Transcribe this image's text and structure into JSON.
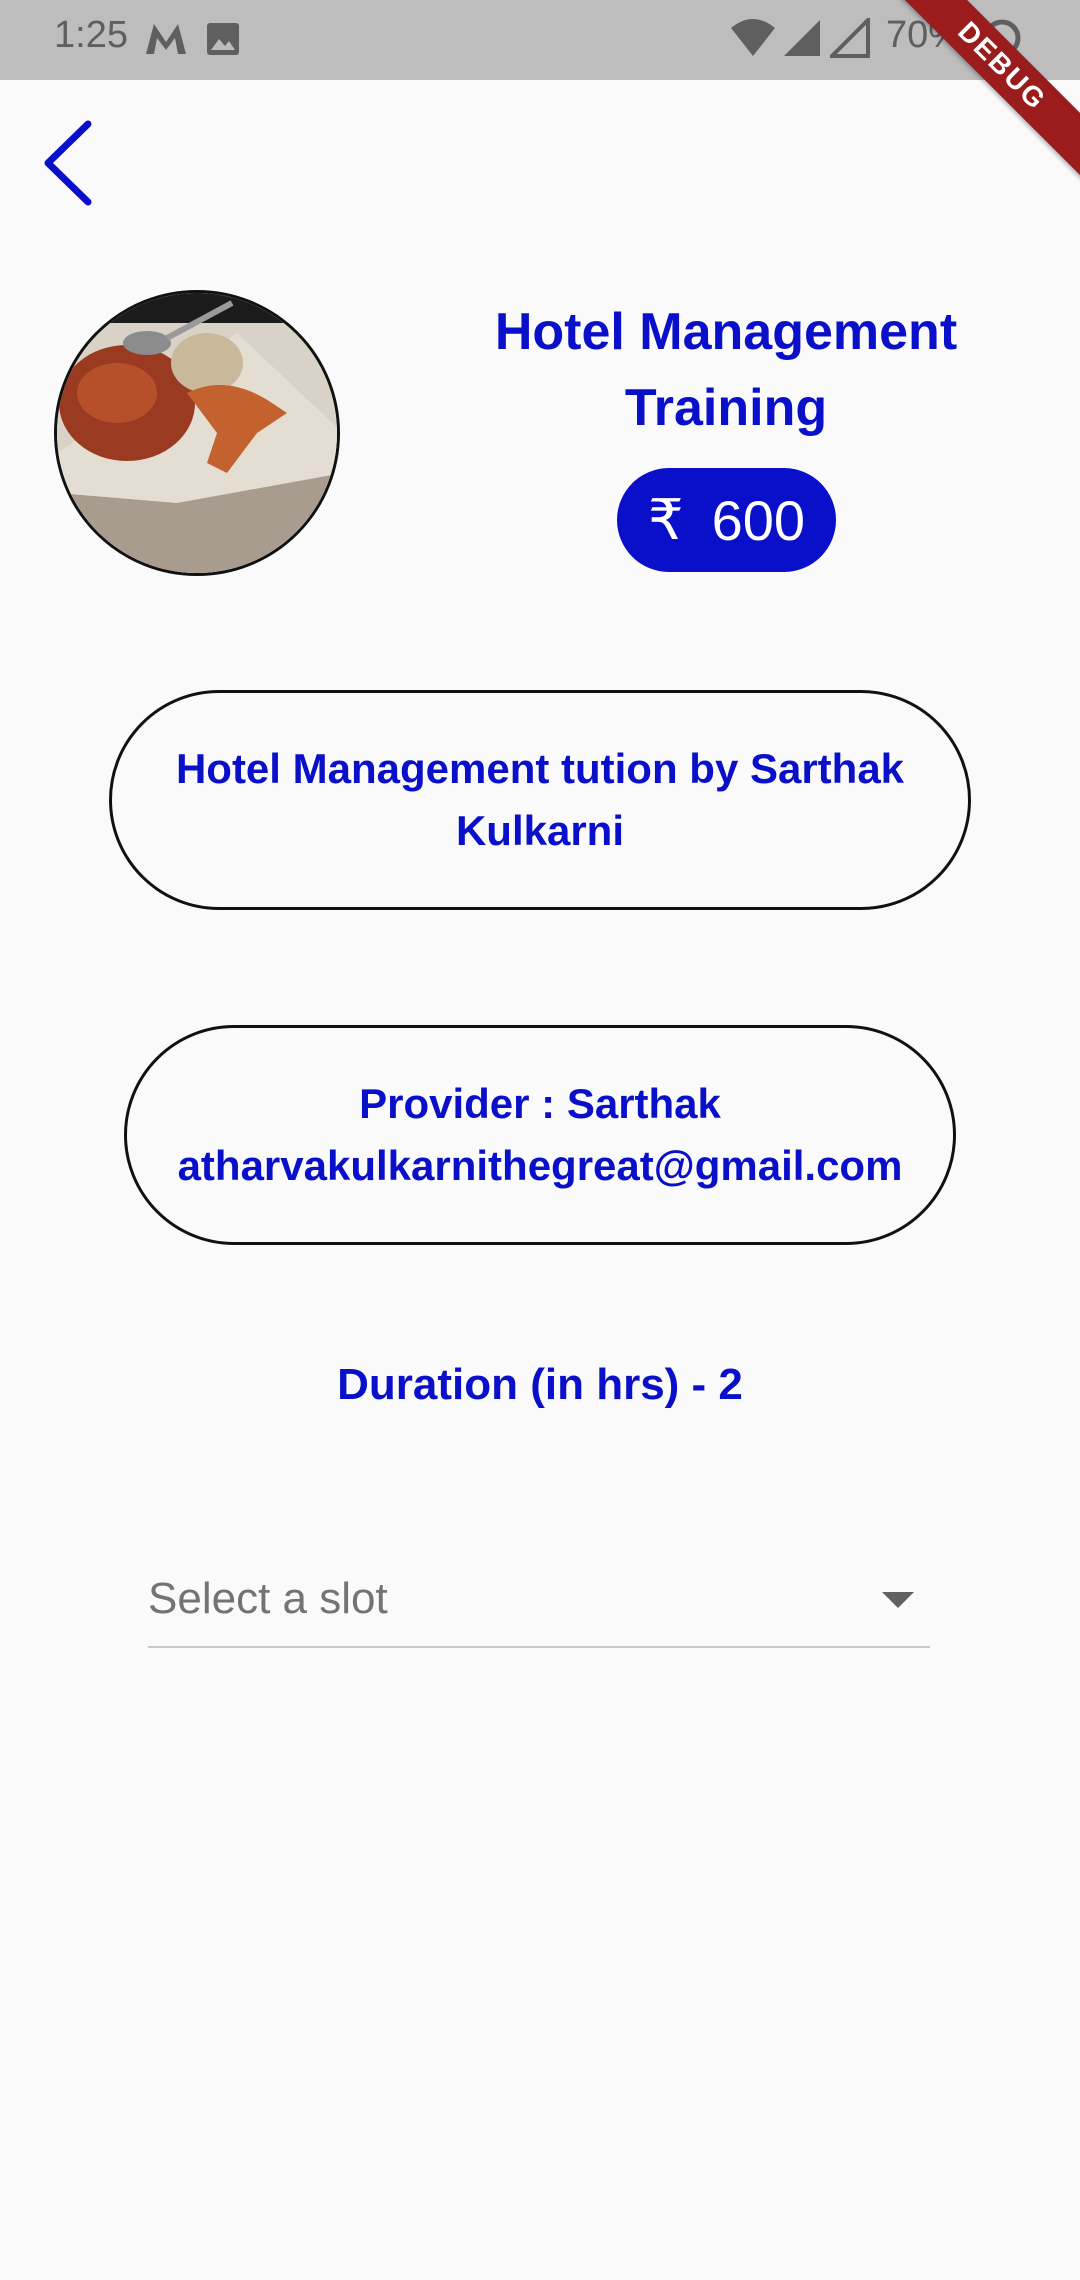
{
  "status_bar": {
    "time": "1:25",
    "battery": "70%",
    "icons": [
      "gmail-m-icon",
      "gallery-icon",
      "wifi-icon",
      "signal-icon",
      "signal-icon",
      "sync-icon"
    ]
  },
  "debug_banner": "DEBUG",
  "header": {
    "title": "Hotel Management Training",
    "currency_symbol": "₹",
    "price": "600"
  },
  "description": "Hotel Management tution by Sarthak Kulkarni",
  "provider": {
    "line1": "Provider : Sarthak",
    "email": "atharvakulkarnithegreat@gmail.com"
  },
  "duration": "Duration (in hrs) -  2",
  "slot_dropdown": {
    "placeholder": "Select a slot"
  },
  "colors": {
    "accent": "#0a10c9",
    "background": "#fafafa",
    "status_bar": "#bdbdbd",
    "debug_ribbon": "#9b1c1c"
  }
}
